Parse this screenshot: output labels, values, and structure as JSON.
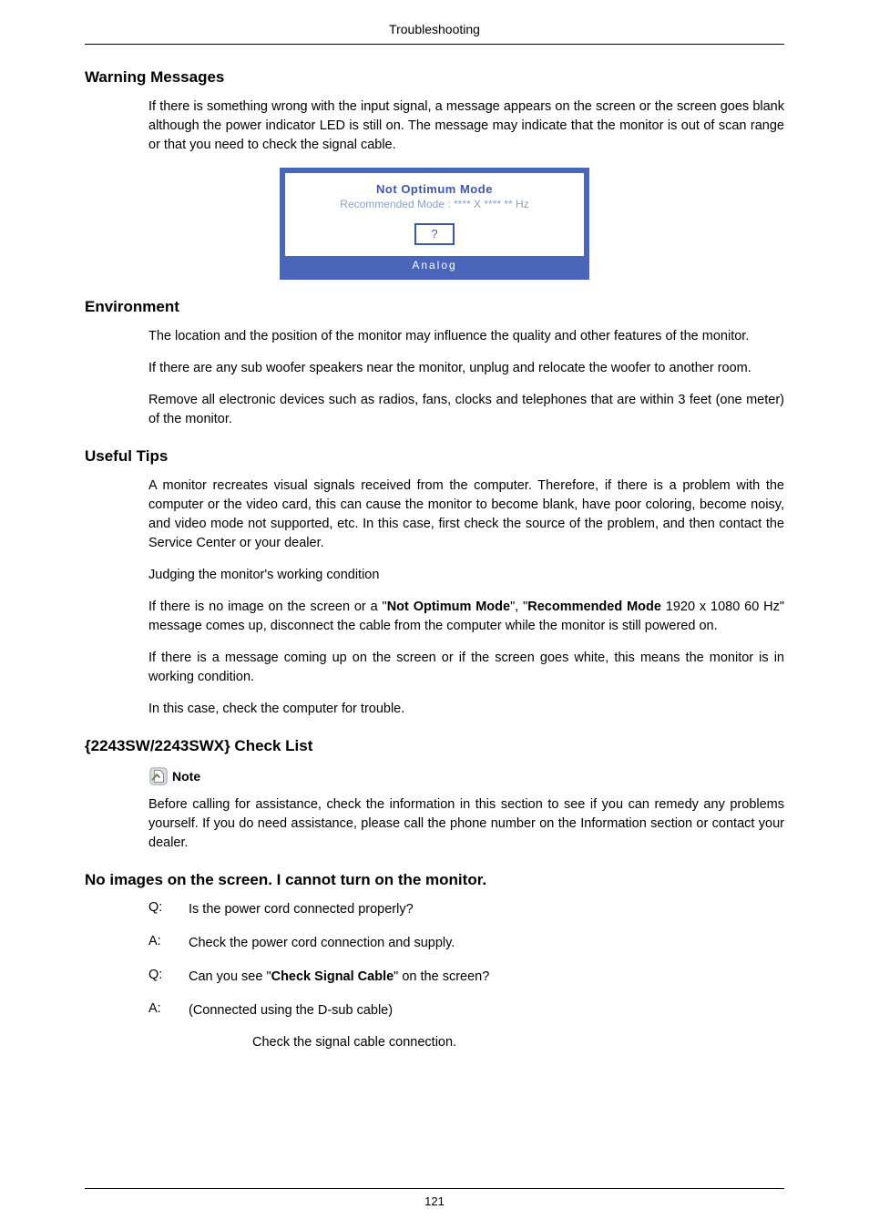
{
  "header": {
    "running": "Troubleshooting"
  },
  "sections": {
    "warning": {
      "heading": "Warning Messages",
      "p1": "If there is something wrong with the input signal, a message appears on the screen or the screen goes blank although the power indicator LED is still on. The message may indicate that the monitor is out of scan range or that you need to check the signal cable."
    },
    "osd": {
      "title": "Not Optimum Mode",
      "recommended": "Recommended Mode : **** X **** ** Hz",
      "button": "?",
      "footer": "Analog"
    },
    "environment": {
      "heading": "Environment",
      "p1": "The location and the position of the monitor may influence the quality and other features of the monitor.",
      "p2": "If there are any sub woofer speakers near the monitor, unplug and relocate the woofer to another room.",
      "p3": "Remove all electronic devices such as radios, fans, clocks and telephones that are within 3 feet (one meter) of the monitor."
    },
    "tips": {
      "heading": "Useful Tips",
      "p1": "A monitor recreates visual signals received from the computer. Therefore, if there is a problem with the computer or the video card, this can cause the monitor to become blank, have poor coloring, become noisy, and video mode not supported, etc. In this case, first check the source of the problem, and then contact the Service Center or your dealer.",
      "p2": "Judging the monitor's working condition",
      "p3_pre": "If there is no image on the screen or a \"",
      "p3_b1": "Not Optimum Mode",
      "p3_mid": "\", \"",
      "p3_b2": "Recommended Mode",
      "p3_post": " 1920 x 1080 60 Hz\" message comes up, disconnect the cable from the computer while the monitor is still powered on.",
      "p4": "If there is a message coming up on the screen or if the screen goes white, this means the monitor is in working condition.",
      "p5": "In this case, check the computer for trouble."
    },
    "checklist": {
      "heading": "{2243SW/2243SWX} Check List",
      "note_label": "Note",
      "note_body": "Before calling for assistance, check the information in this section to see if you can remedy any problems yourself. If you do need assistance, please call the phone number on the Information section or contact your dealer."
    },
    "noimages": {
      "heading": "No images on the screen. I cannot turn on the monitor.",
      "q1": {
        "label": "Q:",
        "text": "Is the power cord connected properly?"
      },
      "a1": {
        "label": "A:",
        "text": "Check the power cord connection and supply."
      },
      "q2": {
        "label": "Q:",
        "pre": "Can you see \"",
        "bold": "Check Signal Cable",
        "post": "\" on the screen?"
      },
      "a2": {
        "label": "A:",
        "text": "(Connected using the D-sub cable)"
      },
      "a2_sub": "Check the signal cable connection."
    }
  },
  "footer": {
    "page": "121"
  }
}
